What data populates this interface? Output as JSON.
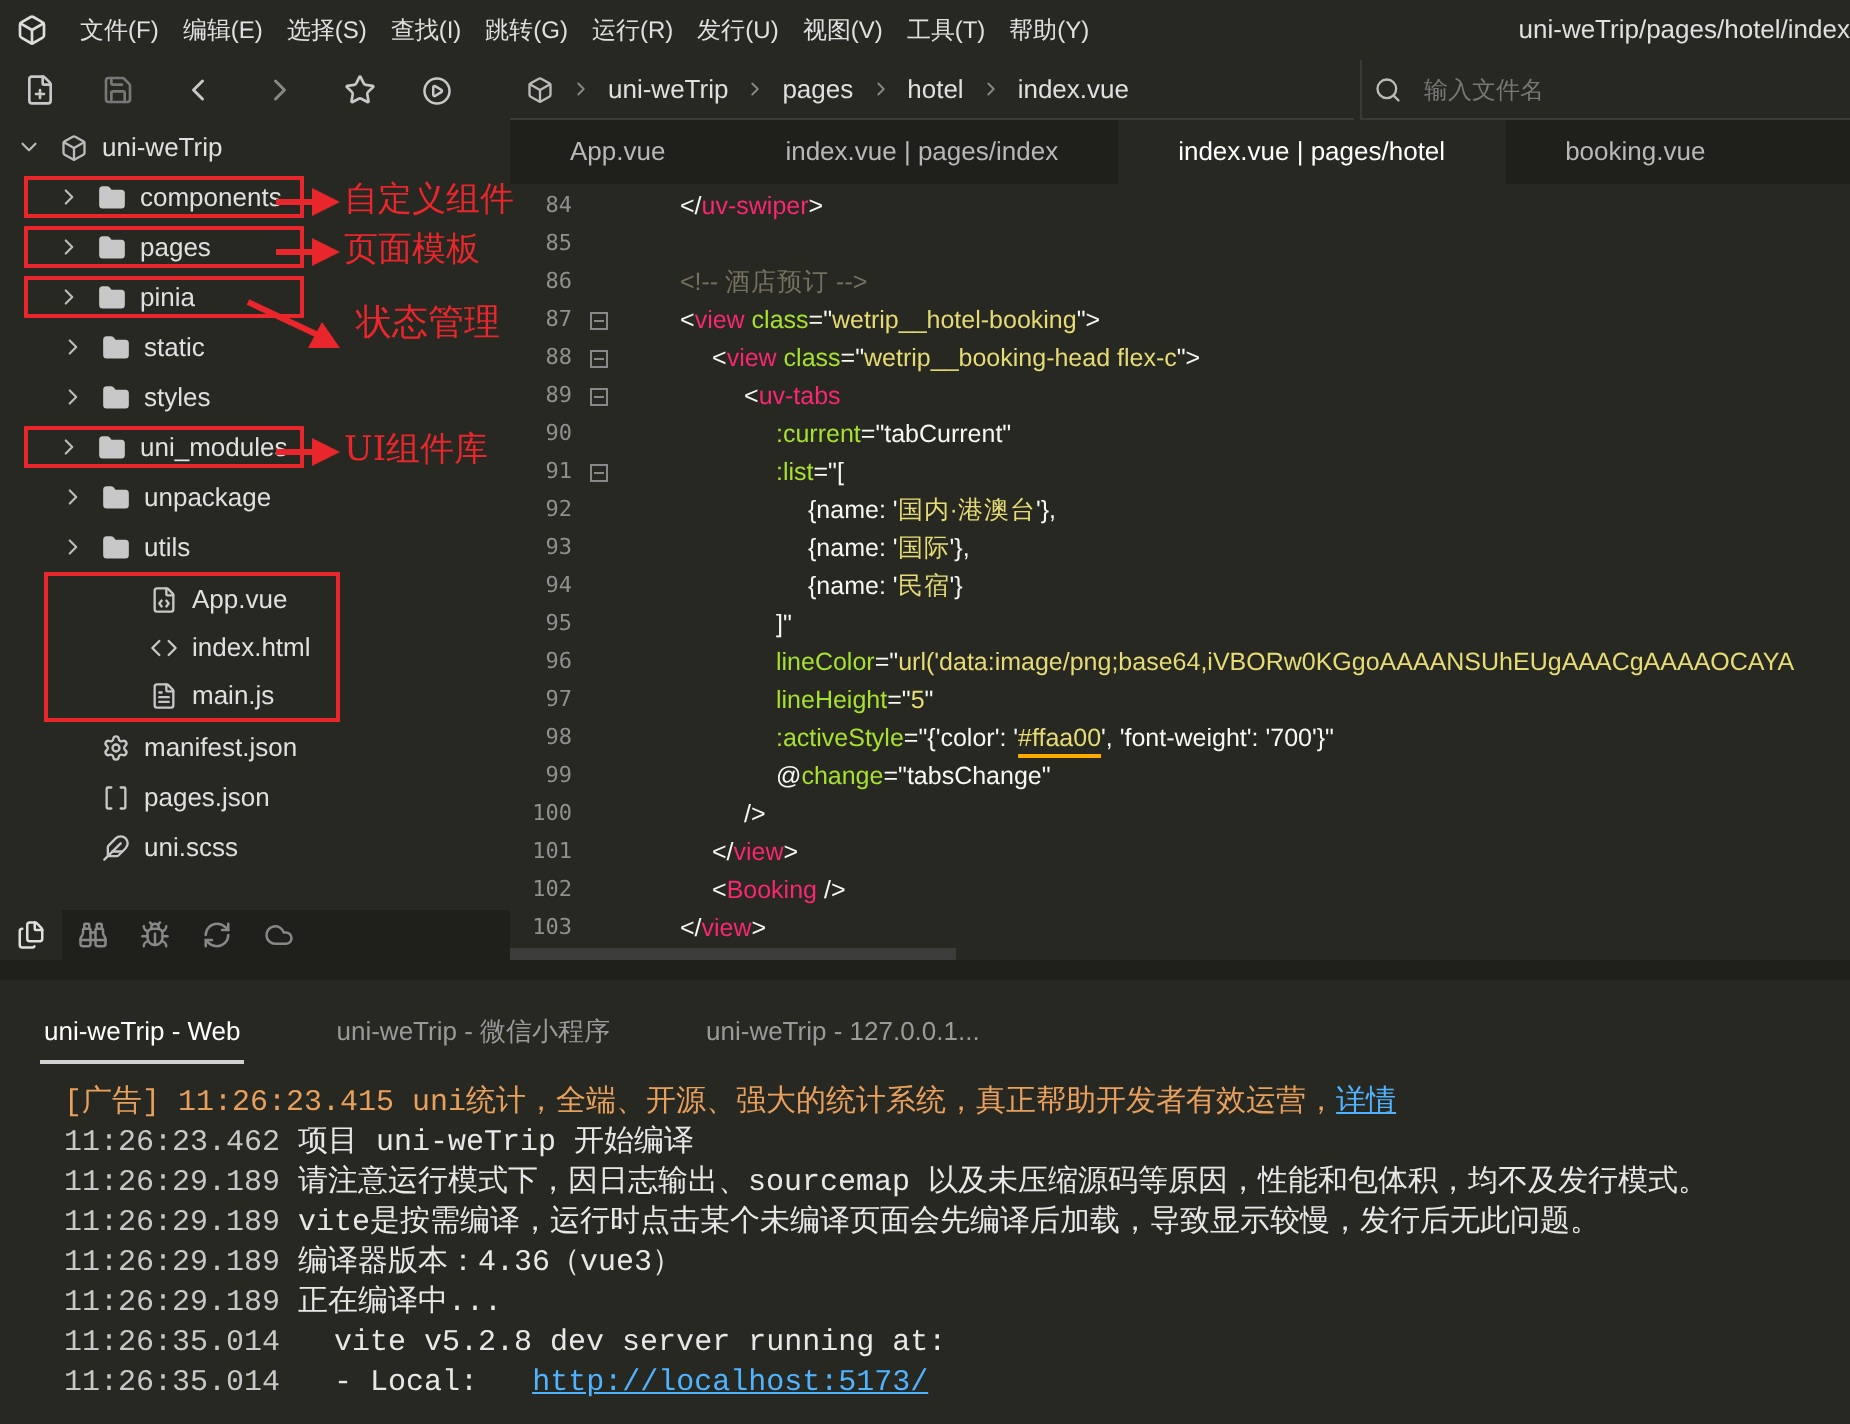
{
  "menu_bar": {
    "items": [
      "文件(F)",
      "编辑(E)",
      "选择(S)",
      "查找(I)",
      "跳转(G)",
      "运行(R)",
      "发行(U)",
      "视图(V)",
      "工具(T)",
      "帮助(Y)"
    ],
    "title": "uni-weTrip/pages/hotel/index"
  },
  "breadcrumb": [
    "uni-weTrip",
    "pages",
    "hotel",
    "index.vue"
  ],
  "file_search": {
    "placeholder": "输入文件名"
  },
  "editor_tabs": [
    {
      "label": "App.vue",
      "selected": false
    },
    {
      "label": "index.vue | pages/index",
      "selected": false
    },
    {
      "label": "index.vue | pages/hotel",
      "selected": true
    },
    {
      "label": "booking.vue",
      "selected": false
    }
  ],
  "explorer": {
    "root": "uni-weTrip",
    "expanded": true,
    "items": [
      {
        "kind": "folder",
        "name": "components",
        "outlined": true,
        "callout": {
          "text": "自定义组件",
          "kind": "straight"
        }
      },
      {
        "kind": "folder",
        "name": "pages",
        "outlined": true,
        "callout": {
          "text": "页面模板",
          "kind": "straight"
        }
      },
      {
        "kind": "folder",
        "name": "pinia",
        "outlined": true,
        "callout": {
          "text": "状态管理",
          "kind": "diagonal"
        }
      },
      {
        "kind": "folder",
        "name": "static",
        "outlined": false
      },
      {
        "kind": "folder",
        "name": "styles",
        "outlined": false
      },
      {
        "kind": "folder",
        "name": "uni_modules",
        "outlined": true,
        "callout": {
          "text": "UI组件库",
          "kind": "straight"
        }
      },
      {
        "kind": "folder",
        "name": "unpackage",
        "outlined": false
      },
      {
        "kind": "folder",
        "name": "utils",
        "outlined": false
      },
      {
        "kind": "vue",
        "name": "App.vue",
        "outlined": false,
        "grouped": true
      },
      {
        "kind": "html",
        "name": "index.html",
        "outlined": false,
        "grouped": true
      },
      {
        "kind": "js",
        "name": "main.js",
        "outlined": false,
        "grouped": true
      },
      {
        "kind": "manifest",
        "name": "manifest.json",
        "outlined": false
      },
      {
        "kind": "json",
        "name": "pages.json",
        "outlined": false
      },
      {
        "kind": "scss",
        "name": "uni.scss",
        "outlined": false
      }
    ]
  },
  "sidebar_tabs": [
    {
      "kind": "files",
      "selected": true
    },
    {
      "kind": "binoculars",
      "selected": false
    },
    {
      "kind": "bug",
      "selected": false
    },
    {
      "kind": "refresh",
      "selected": false
    },
    {
      "kind": "cloud",
      "selected": false
    }
  ],
  "code_lines": [
    {
      "number": "84",
      "foldable": false,
      "tokens": [
        {
          "kind": "p",
          "text": "</"
        },
        {
          "kind": "tag",
          "text": "uv-swiper"
        },
        {
          "kind": "p",
          "text": ">"
        }
      ]
    },
    {
      "number": "85",
      "foldable": false
    },
    {
      "number": "86",
      "foldable": false,
      "tokens": [
        {
          "kind": "comment",
          "text": "<!-- 酒店预订 -->"
        }
      ]
    },
    {
      "number": "87",
      "foldable": true,
      "tokens": [
        {
          "kind": "p",
          "text": "<"
        },
        {
          "kind": "tag",
          "text": "view"
        },
        {
          "kind": "attr",
          "text": " class"
        },
        {
          "kind": "p",
          "text": "=\""
        },
        {
          "kind": "str",
          "text": "wetrip__hotel-booking"
        },
        {
          "kind": "p",
          "text": "\">"
        }
      ],
      "children": [
        {
          "number": "88",
          "foldable": true,
          "tokens": [
            {
              "kind": "p",
              "text": "<"
            },
            {
              "kind": "tag",
              "text": "view"
            },
            {
              "kind": "attr",
              "text": " class"
            },
            {
              "kind": "p",
              "text": "=\""
            },
            {
              "kind": "str",
              "text": "wetrip__booking-head flex-c"
            },
            {
              "kind": "p",
              "text": "\">"
            }
          ],
          "children": [
            {
              "number": "89",
              "foldable": true,
              "tokens": [
                {
                  "kind": "p",
                  "text": "<"
                },
                {
                  "kind": "tag",
                  "text": "uv-tabs"
                }
              ],
              "children": [
                {
                  "number": "90",
                  "foldable": false,
                  "tokens": [
                    {
                      "kind": "attr",
                      "text": ":current"
                    },
                    {
                      "kind": "p",
                      "text": "=\"tabCurrent\""
                    }
                  ]
                },
                {
                  "number": "91",
                  "foldable": true,
                  "tokens": [
                    {
                      "kind": "attr",
                      "text": ":list"
                    },
                    {
                      "kind": "p",
                      "text": "=\"["
                    }
                  ],
                  "children": [
                    {
                      "number": "92",
                      "foldable": false,
                      "tokens": [
                        {
                          "kind": "p",
                          "text": "{name: '"
                        },
                        {
                          "kind": "str",
                          "text": "国内·港澳台"
                        },
                        {
                          "kind": "p",
                          "text": "'},"
                        }
                      ]
                    },
                    {
                      "number": "93",
                      "foldable": false,
                      "tokens": [
                        {
                          "kind": "p",
                          "text": "{name: '"
                        },
                        {
                          "kind": "str",
                          "text": "国际"
                        },
                        {
                          "kind": "p",
                          "text": "'},"
                        }
                      ]
                    },
                    {
                      "number": "94",
                      "foldable": false,
                      "tokens": [
                        {
                          "kind": "p",
                          "text": "{name: '"
                        },
                        {
                          "kind": "str",
                          "text": "民宿"
                        },
                        {
                          "kind": "p",
                          "text": "'}"
                        }
                      ]
                    }
                  ]
                },
                {
                  "number": "95",
                  "foldable": false,
                  "tokens": [
                    {
                      "kind": "p",
                      "text": "]\""
                    }
                  ]
                },
                {
                  "number": "96",
                  "foldable": false,
                  "tokens": [
                    {
                      "kind": "attr",
                      "text": "lineColor"
                    },
                    {
                      "kind": "p",
                      "text": "=\""
                    },
                    {
                      "kind": "str",
                      "text": "url('data:image/png;base64,iVBORw0KGgoAAAANSUhEUgAAACgAAAAOCAYA"
                    }
                  ]
                },
                {
                  "number": "97",
                  "foldable": false,
                  "tokens": [
                    {
                      "kind": "attr",
                      "text": "lineHeight"
                    },
                    {
                      "kind": "p",
                      "text": "=\""
                    },
                    {
                      "kind": "str",
                      "text": "5"
                    },
                    {
                      "kind": "p",
                      "text": "\""
                    }
                  ]
                },
                {
                  "number": "98",
                  "foldable": false,
                  "tokens": [
                    {
                      "kind": "attr",
                      "text": ":activeStyle"
                    },
                    {
                      "kind": "p",
                      "text": "=\"{'color': '"
                    },
                    {
                      "kind": "color",
                      "text": "#ffaa00"
                    },
                    {
                      "kind": "p",
                      "text": "', 'font-weight': '700'}\""
                    }
                  ]
                },
                {
                  "number": "99",
                  "foldable": false,
                  "tokens": [
                    {
                      "kind": "p",
                      "text": "@"
                    },
                    {
                      "kind": "attr",
                      "text": "change"
                    },
                    {
                      "kind": "p",
                      "text": "=\"tabsChange\""
                    }
                  ]
                }
              ]
            },
            {
              "number": "100",
              "foldable": false,
              "tokens": [
                {
                  "kind": "p",
                  "text": "/>"
                }
              ]
            }
          ]
        },
        {
          "number": "101",
          "foldable": false,
          "tokens": [
            {
              "kind": "p",
              "text": "</"
            },
            {
              "kind": "tag",
              "text": "view"
            },
            {
              "kind": "p",
              "text": ">"
            }
          ]
        },
        {
          "number": "102",
          "foldable": false,
          "tokens": [
            {
              "kind": "p",
              "text": "<"
            },
            {
              "kind": "tag",
              "text": "Booking"
            },
            {
              "kind": "p",
              "text": " />"
            }
          ]
        }
      ]
    },
    {
      "number": "103",
      "foldable": false,
      "tokens": [
        {
          "kind": "p",
          "text": "</"
        },
        {
          "kind": "tag",
          "text": "view"
        },
        {
          "kind": "p",
          "text": ">"
        }
      ]
    }
  ],
  "console_tabs": [
    {
      "label": "uni-weTrip - Web",
      "selected": true
    },
    {
      "label": "uni-weTrip - 微信小程序",
      "selected": false
    },
    {
      "label": "uni-weTrip - 127.0.0.1...",
      "selected": false
    }
  ],
  "console_lines": [
    {
      "kind": "ad",
      "prefix": "[广告]",
      "time": "11:26:23.415",
      "text": "uni统计，全端、开源、强大的统计系统，真正帮助开发者有效运营，",
      "link": "详情"
    },
    {
      "kind": "log",
      "time": "11:26:23.462",
      "text": "项目 uni-weTrip 开始编译"
    },
    {
      "kind": "log",
      "time": "11:26:29.189",
      "text": "请注意运行模式下，因日志输出、sourcemap 以及未压缩源码等原因，性能和包体积，均不及发行模式。"
    },
    {
      "kind": "log",
      "time": "11:26:29.189",
      "text": "vite是按需编译，运行时点击某个未编译页面会先编译后加载，导致显示较慢，发行后无此问题。"
    },
    {
      "kind": "log",
      "time": "11:26:29.189",
      "text": "编译器版本：4.36（vue3）"
    },
    {
      "kind": "log",
      "time": "11:26:29.189",
      "text": "正在编译中..."
    },
    {
      "kind": "log",
      "time": "11:26:35.014",
      "text": "  vite v5.2.8 dev server running at:"
    },
    {
      "kind": "log",
      "time": "11:26:35.014",
      "text": "  - Local:   ",
      "link": "http://localhost:5173/"
    }
  ]
}
